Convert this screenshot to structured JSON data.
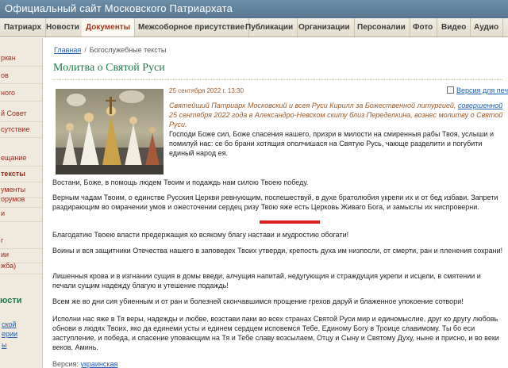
{
  "header": {
    "site_title": "Официальный сайт Московского Патриархата"
  },
  "topnav": [
    {
      "label": "Патриарх"
    },
    {
      "label": "Новости"
    },
    {
      "label": "Документы"
    },
    {
      "label": "Межсоборное присутствие"
    },
    {
      "label": "Публикации"
    },
    {
      "label": "Организации"
    },
    {
      "label": "Персоналии"
    },
    {
      "label": "Фото"
    },
    {
      "label": "Видео"
    },
    {
      "label": "Аудио"
    }
  ],
  "sidebar": {
    "items": [
      {
        "label": "рквн"
      },
      {
        "label": "ов"
      },
      {
        "label": "ного"
      },
      {
        "label": "й Совет"
      },
      {
        "label": "сутствие"
      },
      {
        "label": "ещание"
      },
      {
        "label": "тексты"
      },
      {
        "label": "ументы"
      },
      {
        "label": "орумов"
      },
      {
        "label": "и"
      },
      {
        "label": "г"
      },
      {
        "label": "ии"
      },
      {
        "label": "жба)"
      }
    ],
    "heading": "юсти",
    "links": [
      {
        "label": "ской"
      },
      {
        "label": "ерии"
      },
      {
        "label": "ы"
      }
    ]
  },
  "breadcrumb": {
    "home": "Главная",
    "separator": "/",
    "current": "Богослужебные тексты"
  },
  "article": {
    "title": "Молитва о Святой Руси",
    "date": "25 сентября 2022 г. 13:30",
    "print_label": "Версия для печати",
    "intro_1": "Святейший Патриарх Московский и всея Руси Кирилл за Божественной литургией, ",
    "intro_link": "совершенной",
    "intro_2": " 25 сентября 2022 года в Александро-Невском скиту близ Переделкина, вознес молитву о Святой Руси.",
    "paragraphs": [
      "Господи Боже сил, Боже спасения нашего, призри в милости на смиренныя рабы Твоя, услыши и помилуй нас: се бо брани хотящия ополчишася на Святую Русь, чающе разделити и погубити единый народ ея.",
      "Востани, Боже, в помощь людем Твоим и подаждь нам силою Твоею победу.",
      "Верным чадам Твоим, о единстве Русския Церкви ревнующим, поспешествуй, в духе братолюбия укрепи их и от бед избави. Запрети раздирающим во омрачении умов и ожесточении сердец ризу Твою яже есть Церковь Живаго Бога, и замыслы их ниспроверни.",
      "Благодатию Твоею власти предержащия ко всякому благу настави и мудростию обогати!",
      "Воины и вся защитники Отечества нашего в заповедех Твоих утверди, крепость духа им низпосли, от смерти, ран и пленения сохрани!",
      "Лишенныя крова и в изгнании сущия в домы введи, алчущия напитай, недугующия и страждущия укрепи и исцели, в смятении и печали сущим надежду благую и утешение подаждь!",
      "Всем же во дни сия убиенным и от ран и болезней скончавшимся прощение грехов даруй и блаженное упокоение сотвори!",
      "Исполни нас яже в Тя веры, надежды и любве, возстави паки во всех странах Святой Руси мир и единомыслие, друг ко другу любовь обнови в людях Твоих, яко да единеми усты и единем сердцем исповемся Тебе, Единому Богу в Троице славимому. Ты бо еси заступление, и победа, и спасение уповающим на Тя и Тебе славу возсылаем, Отцу и Сыну и Святому Духу, ныне и присно, и во веки веков. Аминь."
    ],
    "version_label": "Версия:",
    "version_link": "украинская"
  },
  "colors": {
    "header": "#5f7f97",
    "title_green": "#1f7a49",
    "link_blue": "#1f5fb4",
    "accent_red": "#e02020",
    "meta_brown": "#9a5a28"
  }
}
